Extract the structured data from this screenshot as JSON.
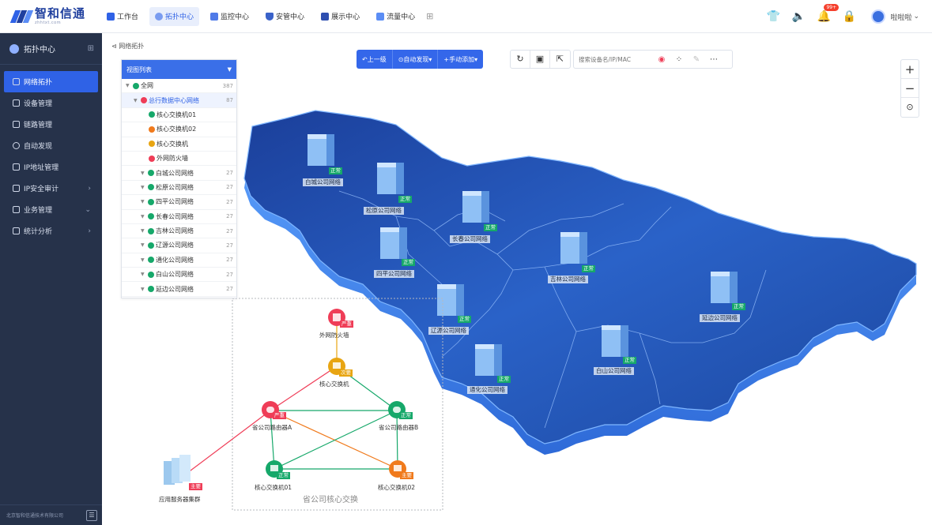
{
  "app": {
    "logo_text": "智和信通",
    "logo_sub": "zhhtxt.com"
  },
  "topnav": [
    {
      "label": "工作台",
      "active": false
    },
    {
      "label": "拓扑中心",
      "active": true
    },
    {
      "label": "监控中心",
      "active": false
    },
    {
      "label": "安管中心",
      "active": false
    },
    {
      "label": "展示中心",
      "active": false
    },
    {
      "label": "流量中心",
      "active": false
    }
  ],
  "header": {
    "notify_badge": "99+",
    "username": "啦啦啦"
  },
  "sidebar": {
    "title": "拓扑中心",
    "items": [
      {
        "label": "网络拓扑",
        "active": true,
        "arrow": ""
      },
      {
        "label": "设备管理",
        "active": false,
        "arrow": ""
      },
      {
        "label": "链路管理",
        "active": false,
        "arrow": ""
      },
      {
        "label": "自动发现",
        "active": false,
        "arrow": ""
      },
      {
        "label": "IP地址管理",
        "active": false,
        "arrow": ""
      },
      {
        "label": "IP安全审计",
        "active": false,
        "arrow": "›"
      },
      {
        "label": "业务管理",
        "active": false,
        "arrow": "⌄"
      },
      {
        "label": "统计分析",
        "active": false,
        "arrow": "›"
      }
    ],
    "footer": "北京智和信通技术有限公司"
  },
  "breadcrumb": "网络拓扑",
  "toolbar": {
    "back": "上一级",
    "auto_discover": "自动发现",
    "manual_add": "手动添加",
    "search_placeholder": "搜索设备名/IP/MAC"
  },
  "tree": {
    "title": "视图列表",
    "rows": [
      {
        "label": "全网",
        "count": "387",
        "level": 0,
        "color": "#16a86a",
        "highlight": false
      },
      {
        "label": "总行数据中心网络",
        "count": "87",
        "level": 1,
        "color": "#ef3d57",
        "highlight": true
      },
      {
        "label": "核心交换机01",
        "count": "",
        "level": 2,
        "color": "#16a86a",
        "highlight": false
      },
      {
        "label": "核心交换机02",
        "count": "",
        "level": 2,
        "color": "#f07a1c",
        "highlight": false
      },
      {
        "label": "核心交换机",
        "count": "",
        "level": 2,
        "color": "#e8a512",
        "highlight": false
      },
      {
        "label": "外网防火墙",
        "count": "",
        "level": 2,
        "color": "#ef3d57",
        "highlight": false
      },
      {
        "label": "白城公司网络",
        "count": "27",
        "level": 1,
        "color": "#16a86a",
        "highlight": false
      },
      {
        "label": "松原公司网络",
        "count": "27",
        "level": 1,
        "color": "#16a86a",
        "highlight": false
      },
      {
        "label": "四平公司网络",
        "count": "27",
        "level": 1,
        "color": "#16a86a",
        "highlight": false
      },
      {
        "label": "长春公司网络",
        "count": "27",
        "level": 1,
        "color": "#16a86a",
        "highlight": false
      },
      {
        "label": "吉林公司网络",
        "count": "27",
        "level": 1,
        "color": "#16a86a",
        "highlight": false
      },
      {
        "label": "辽源公司网络",
        "count": "27",
        "level": 1,
        "color": "#16a86a",
        "highlight": false
      },
      {
        "label": "通化公司网络",
        "count": "27",
        "level": 1,
        "color": "#16a86a",
        "highlight": false
      },
      {
        "label": "白山公司网络",
        "count": "27",
        "level": 1,
        "color": "#16a86a",
        "highlight": false
      },
      {
        "label": "延边公司网络",
        "count": "27",
        "level": 1,
        "color": "#16a86a",
        "highlight": false
      }
    ]
  },
  "map_sites": [
    {
      "name": "白城公司网络",
      "status": "正常"
    },
    {
      "name": "松原公司网络",
      "status": "正常"
    },
    {
      "name": "长春公司网络",
      "status": "正常"
    },
    {
      "name": "四平公司网络",
      "status": "正常"
    },
    {
      "name": "吉林公司网络",
      "status": "正常"
    },
    {
      "name": "辽源公司网络",
      "status": "正常"
    },
    {
      "name": "延边公司网络",
      "status": "正常"
    },
    {
      "name": "白山公司网络",
      "status": "正常"
    },
    {
      "name": "通化公司网络",
      "status": "正常"
    }
  ],
  "topology": {
    "title": "省公司核心交换",
    "nodes": [
      {
        "name": "外网防火墙",
        "status": "严重",
        "color": "#ef3d57"
      },
      {
        "name": "核心交换机",
        "status": "次要",
        "color": "#e8a512"
      },
      {
        "name": "省公司路由器A",
        "status": "严重",
        "color": "#ef3d57"
      },
      {
        "name": "省公司路由器B",
        "status": "正常",
        "color": "#16a86a"
      },
      {
        "name": "核心交换机01",
        "status": "正常",
        "color": "#16a86a"
      },
      {
        "name": "核心交换机02",
        "status": "主要",
        "color": "#f07a1c"
      },
      {
        "name": "应用服务器集群",
        "status": "主要",
        "color": "#ef3d57"
      }
    ]
  },
  "colors": {
    "primary": "#2f62e6",
    "sidebar_bg": "#26324a",
    "normal": "#16a86a",
    "critical": "#ef3d57",
    "major": "#f07a1c",
    "minor": "#e8a512"
  }
}
